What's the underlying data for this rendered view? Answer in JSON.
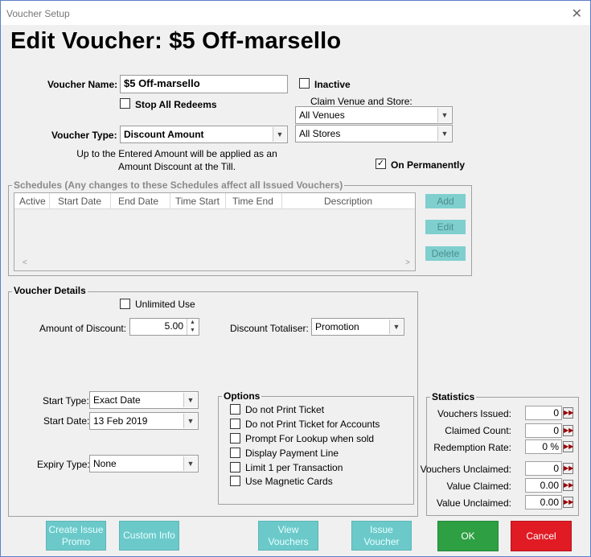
{
  "window": {
    "title": "Voucher Setup"
  },
  "heading": "Edit Voucher: $5 Off-marsello",
  "voucher_name": {
    "label": "Voucher Name:",
    "value": "$5 Off-marsello"
  },
  "inactive": {
    "label": "Inactive",
    "checked": false
  },
  "stop_all_redeems": {
    "label": "Stop All Redeems",
    "checked": false
  },
  "claim_venue": {
    "label": "Claim Venue and Store:",
    "venue": "All Venues",
    "store": "All Stores"
  },
  "voucher_type": {
    "label": "Voucher Type:",
    "value": "Discount Amount",
    "description": "Up to the Entered Amount will be applied as an Amount Discount at the Till."
  },
  "on_permanently": {
    "label": "On Permanently",
    "checked": true
  },
  "schedules": {
    "title": "Schedules (Any changes to these Schedules affect all Issued Vouchers)",
    "columns": [
      "Active",
      "Start Date",
      "End Date",
      "Time Start",
      "Time End",
      "Description"
    ],
    "buttons": {
      "add": "Add",
      "edit": "Edit",
      "delete": "Delete"
    }
  },
  "voucher_details": {
    "title": "Voucher Details",
    "unlimited_use": {
      "label": "Unlimited Use",
      "checked": false
    },
    "amount_label": "Amount of Discount:",
    "amount_value": "5.00",
    "totaliser_label": "Discount Totaliser:",
    "totaliser_value": "Promotion",
    "start_type_label": "Start Type:",
    "start_type_value": "Exact Date",
    "start_date_label": "Start Date:",
    "start_date_value": "13 Feb 2019",
    "expiry_type_label": "Expiry Type:",
    "expiry_type_value": "None"
  },
  "options": {
    "title": "Options",
    "items": [
      {
        "label": "Do not Print Ticket",
        "checked": false
      },
      {
        "label": "Do not Print Ticket for Accounts",
        "checked": false
      },
      {
        "label": "Prompt For Lookup when sold",
        "checked": false
      },
      {
        "label": "Display Payment Line",
        "checked": false
      },
      {
        "label": "Limit 1 per Transaction",
        "checked": false
      },
      {
        "label": "Use Magnetic Cards",
        "checked": false
      }
    ]
  },
  "statistics": {
    "title": "Statistics",
    "rows": [
      {
        "label": "Vouchers Issued:",
        "value": "0"
      },
      {
        "label": "Claimed Count:",
        "value": "0"
      },
      {
        "label": "Redemption Rate:",
        "value": "0 %"
      },
      {
        "label": "Vouchers Unclaimed:",
        "value": "0"
      },
      {
        "label": "Value Claimed:",
        "value": "0.00"
      },
      {
        "label": "Value Unclaimed:",
        "value": "0.00"
      }
    ]
  },
  "footer": {
    "create_issue_promo": "Create Issue Promo",
    "custom_info": "Custom Info",
    "view_vouchers": "View Vouchers",
    "issue_voucher": "Issue Voucher",
    "ok": "OK",
    "cancel": "Cancel"
  },
  "colors": {
    "teal_button": "#6cc9ca",
    "ok_green": "#2ea043",
    "cancel_red": "#e01b24"
  }
}
